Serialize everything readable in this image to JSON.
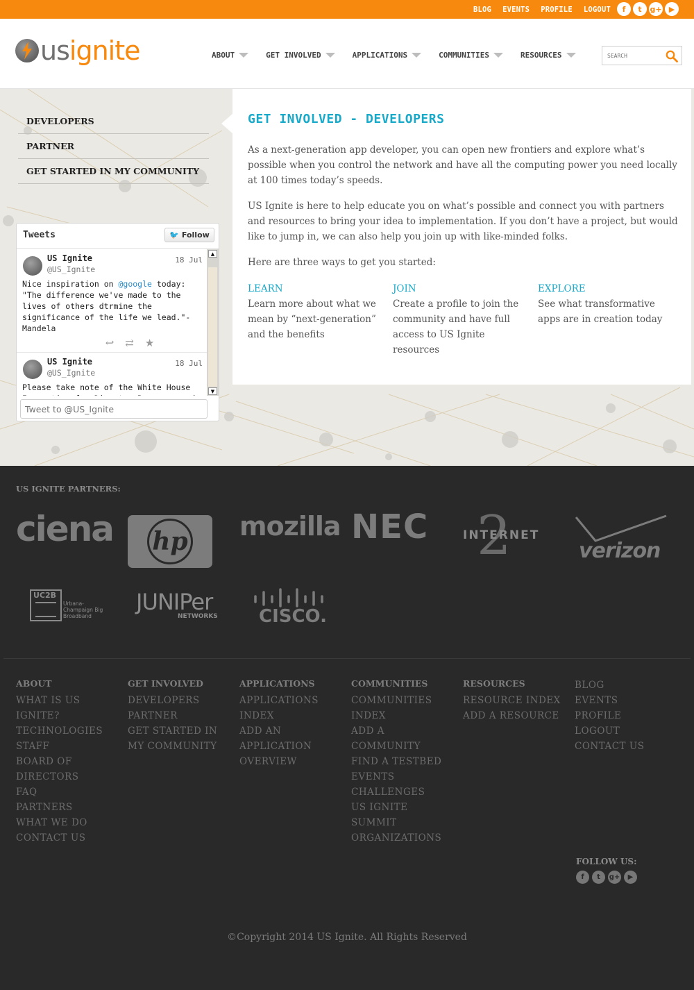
{
  "colors": {
    "accent_orange": "#f7890f",
    "title_cyan": "#19a9c9",
    "footer_bg": "#292929"
  },
  "topbar": {
    "links": [
      "BLOG",
      "EVENTS",
      "PROFILE",
      "LOGOUT"
    ],
    "social_icons": [
      "facebook-icon",
      "twitter-icon",
      "google-plus-icon",
      "youtube-icon"
    ]
  },
  "header": {
    "logo_us": "us",
    "logo_ignite": "ignite",
    "nav": [
      "ABOUT",
      "GET INVOLVED",
      "APPLICATIONS",
      "COMMUNITIES",
      "RESOURCES"
    ],
    "search_placeholder": "SEARCH"
  },
  "sidebar": {
    "items": [
      "DEVELOPERS",
      "PARTNER",
      "GET STARTED IN MY COMMUNITY"
    ]
  },
  "tweets_widget": {
    "title": "Tweets",
    "follow_label": "Follow",
    "input_placeholder": "Tweet to @US_Ignite",
    "tweets": [
      {
        "name": "US Ignite",
        "handle": "@US_Ignite",
        "date": "18 Jul",
        "text_before": "Nice inspiration on ",
        "mention": "@google",
        "text_after": " today: \"The difference we've made to the lives of others dtrmine the significance of the life we lead.\"-Mandela"
      },
      {
        "name": "US Ignite",
        "handle": "@US_Ignite",
        "date": "18 Jul",
        "text_before": "Please take note of the White House Innovation for Disaster Response and",
        "mention": "",
        "text_after": ""
      }
    ]
  },
  "content": {
    "title": "GET INVOLVED - DEVELOPERS",
    "para1": "As a next-generation app developer, you can open new frontiers and explore what’s possible when you control the network and have all the computing power you need locally at 100 times today’s speeds.",
    "para2": "US Ignite is here to help educate you on what’s possible and connect you with partners and resources to bring your idea to implementation. If you don’t have a project, but would like to jump in, we can also help you join up with like-minded folks.",
    "para3": "Here are three ways to get you started:",
    "columns": [
      {
        "heading": "LEARN",
        "text": "Learn more about what we mean by “next-generation” and the benefits"
      },
      {
        "heading": "JOIN",
        "text": "Create a profile to join the community and have full access to US Ignite resources"
      },
      {
        "heading": "EXPLORE",
        "text": "See what transformative apps are in creation today"
      }
    ]
  },
  "footer": {
    "partners_heading": "US IGNITE PARTNERS:",
    "partner_logos": [
      "ciena",
      "hp",
      "mozilla",
      "NEC",
      "INTERNET",
      "verizon",
      "UC2B",
      "Urbana-Champaign Big Broadband",
      "JUNIPer",
      "NETWORKS",
      "CISCO."
    ],
    "columns": [
      {
        "heading": "ABOUT",
        "links": [
          "WHAT IS US IGNITE?",
          "TECHNOLOGIES",
          "STAFF",
          "BOARD OF DIRECTORS",
          "FAQ",
          "PARTNERS",
          "WHAT WE DO",
          "CONTACT US"
        ]
      },
      {
        "heading": "GET INVOLVED",
        "links": [
          "DEVELOPERS",
          "PARTNER",
          "GET STARTED IN MY COMMUNITY"
        ]
      },
      {
        "heading": "APPLICATIONS",
        "links": [
          "APPLICATIONS INDEX",
          "ADD AN APPLICATION",
          "OVERVIEW"
        ]
      },
      {
        "heading": "COMMUNITIES",
        "links": [
          "COMMUNITIES INDEX",
          "ADD A COMMUNITY",
          "FIND A TESTBED",
          "EVENTS",
          "CHALLENGES",
          "US IGNITE SUMMIT",
          "ORGANIZATIONS"
        ]
      },
      {
        "heading": "RESOURCES",
        "links": [
          "RESOURCE INDEX",
          "ADD A RESOURCE"
        ]
      },
      {
        "heading": "",
        "links": [
          "BLOG",
          "EVENTS",
          "PROFILE",
          "LOGOUT",
          "CONTACT US"
        ]
      }
    ],
    "follow_heading": "FOLLOW US:",
    "copyright": "©Copyright 2014 US Ignite. All Rights Reserved"
  }
}
